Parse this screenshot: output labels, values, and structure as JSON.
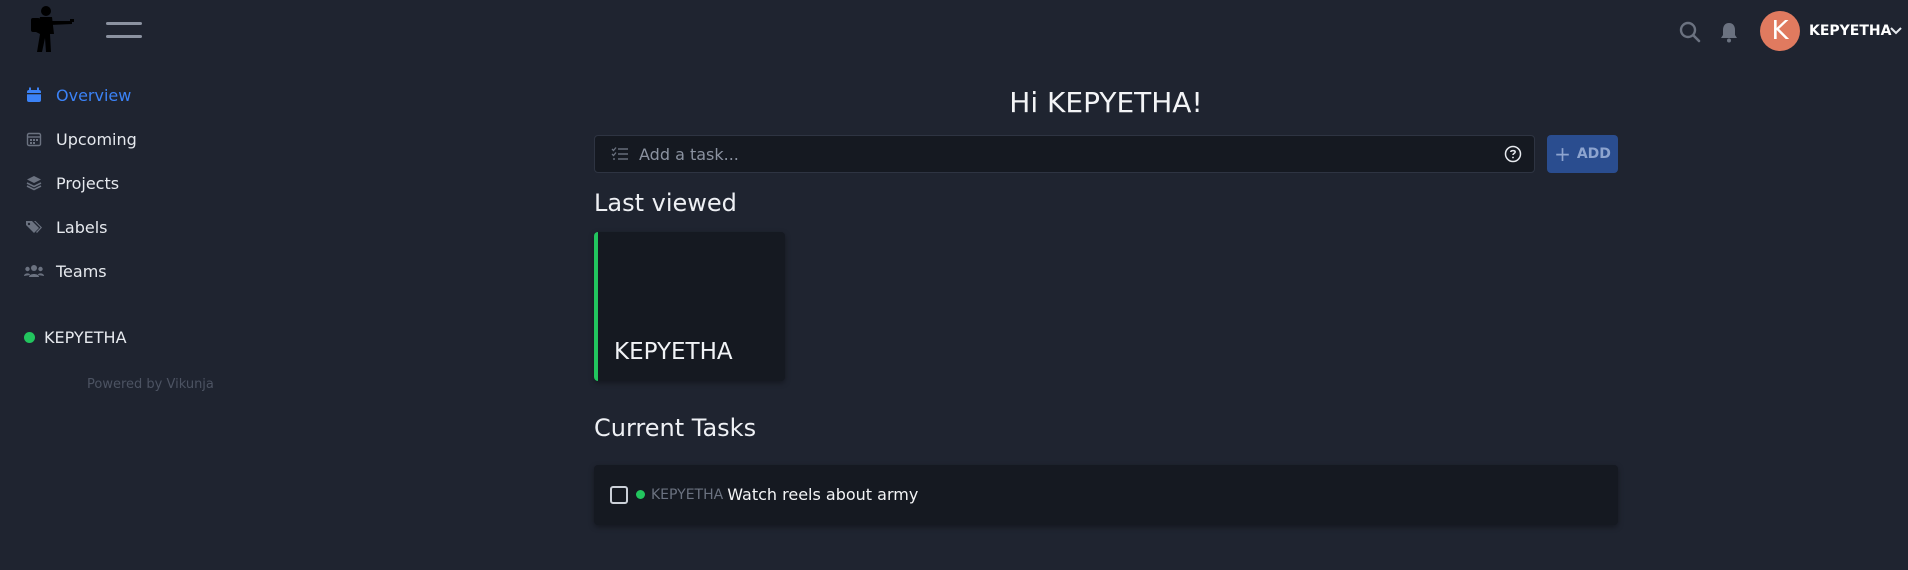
{
  "app": {
    "logo_name": "soldier-logo",
    "accent": "#3b82f6",
    "project_color": "#22c55e"
  },
  "header": {
    "user": {
      "avatar_initial": "K",
      "avatar_color": "#e07a5f",
      "name": "KEPYETHA"
    }
  },
  "sidebar": {
    "items": [
      {
        "label": "Overview",
        "icon": "calendar-icon",
        "active": true
      },
      {
        "label": "Upcoming",
        "icon": "calendar-grid-icon",
        "active": false
      },
      {
        "label": "Projects",
        "icon": "layers-icon",
        "active": false
      },
      {
        "label": "Labels",
        "icon": "tags-icon",
        "active": false
      },
      {
        "label": "Teams",
        "icon": "users-icon",
        "active": false
      }
    ],
    "projects": [
      {
        "label": "KEPYETHA",
        "color": "#22c55e"
      }
    ],
    "powered_by": "Powered by Vikunja"
  },
  "main": {
    "greeting": "Hi KEPYETHA!",
    "add_task": {
      "placeholder": "Add a task...",
      "button_label": "ADD"
    },
    "last_viewed": {
      "title": "Last viewed",
      "cards": [
        {
          "title": "KEPYETHA",
          "color": "#22c55e"
        }
      ]
    },
    "current_tasks": {
      "title": "Current Tasks",
      "tasks": [
        {
          "project": "KEPYETHA",
          "title": "Watch reels about army",
          "done": false
        }
      ]
    }
  }
}
